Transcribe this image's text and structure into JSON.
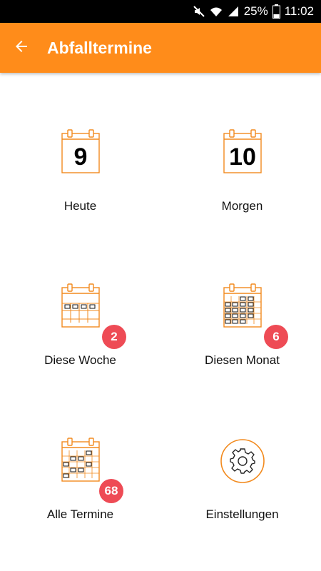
{
  "status_bar": {
    "battery": "25%",
    "time": "11:02",
    "icons": [
      "mute-icon",
      "wifi-icon",
      "signal-icon",
      "battery-icon"
    ]
  },
  "app_bar": {
    "title": "Abfalltermine",
    "back_icon": "arrow-left-icon",
    "color": "#FF8C1A"
  },
  "tiles": [
    {
      "label": "Heute",
      "icon": "calendar-day-icon",
      "day": "9"
    },
    {
      "label": "Morgen",
      "icon": "calendar-day-icon",
      "day": "10"
    },
    {
      "label": "Diese Woche",
      "icon": "calendar-week-icon",
      "badge": "2"
    },
    {
      "label": "Diesen Monat",
      "icon": "calendar-month-icon",
      "badge": "6"
    },
    {
      "label": "Alle Termine",
      "icon": "calendar-all-icon",
      "badge": "68"
    },
    {
      "label": "Einstellungen",
      "icon": "gear-icon"
    }
  ],
  "colors": {
    "accent": "#FF8C1A",
    "badge": "#EE4B55"
  }
}
